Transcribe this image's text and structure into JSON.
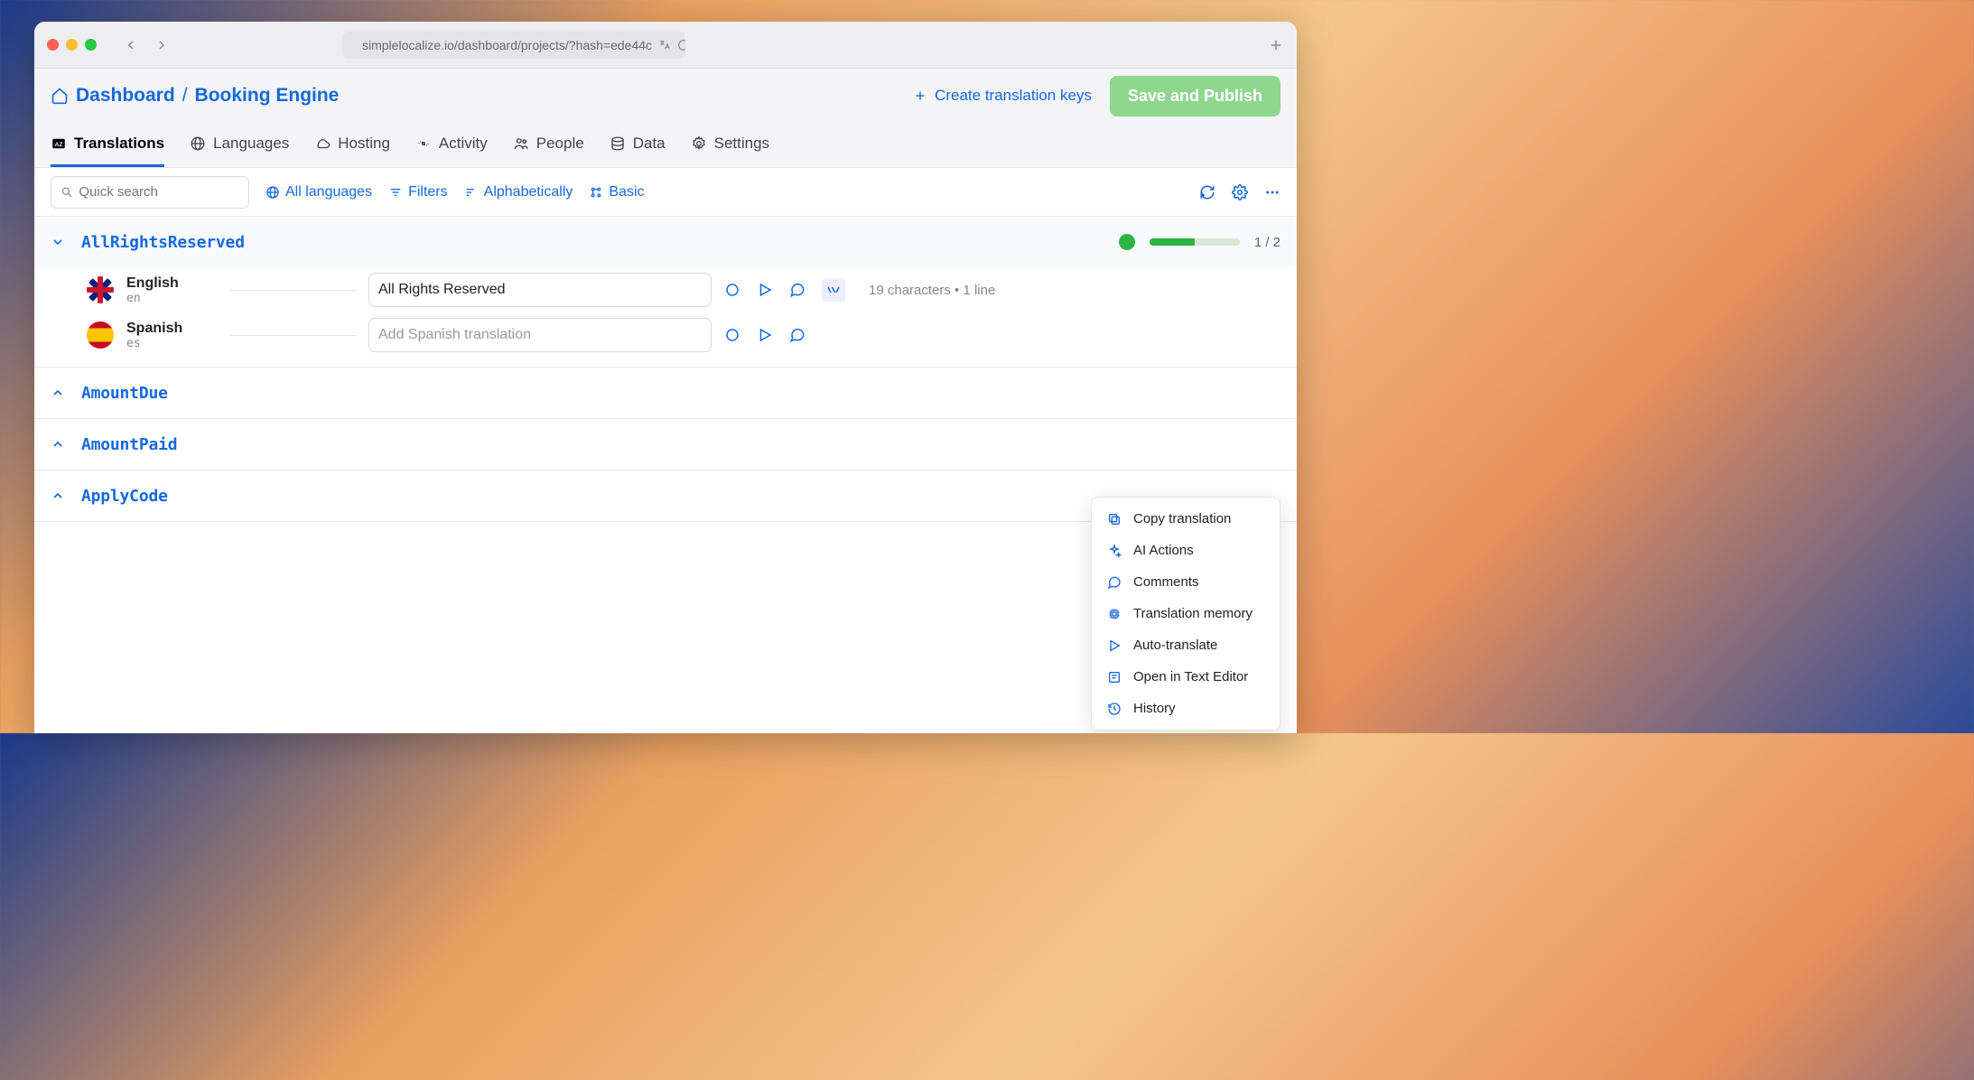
{
  "browser": {
    "url": "simplelocalize.io/dashboard/projects/?hash=ede44c"
  },
  "header": {
    "dashboard_label": "Dashboard",
    "separator": "/",
    "project_name": "Booking Engine",
    "create_keys_label": "Create translation keys",
    "publish_label": "Save and Publish"
  },
  "tabs": [
    {
      "label": "Translations",
      "active": true
    },
    {
      "label": "Languages",
      "active": false
    },
    {
      "label": "Hosting",
      "active": false
    },
    {
      "label": "Activity",
      "active": false
    },
    {
      "label": "People",
      "active": false
    },
    {
      "label": "Data",
      "active": false
    },
    {
      "label": "Settings",
      "active": false
    }
  ],
  "toolbar": {
    "search_placeholder": "Quick search",
    "all_languages": "All languages",
    "filters": "Filters",
    "sort": "Alphabetically",
    "view": "Basic"
  },
  "keys": [
    {
      "name": "AllRightsReserved",
      "expanded": true,
      "progress_done": 1,
      "progress_total": 2,
      "progress_text": "1 / 2",
      "translations": [
        {
          "lang_name": "English",
          "lang_code": "en",
          "flag": "uk",
          "value": "All Rights Reserved",
          "placeholder": "",
          "char_info": "19 characters • 1 line"
        },
        {
          "lang_name": "Spanish",
          "lang_code": "es",
          "flag": "es",
          "value": "",
          "placeholder": "Add Spanish translation",
          "char_info": ""
        }
      ]
    },
    {
      "name": "AmountDue",
      "expanded": false
    },
    {
      "name": "AmountPaid",
      "expanded": false
    },
    {
      "name": "ApplyCode",
      "expanded": false
    }
  ],
  "context_menu": [
    {
      "label": "Copy translation",
      "icon": "copy"
    },
    {
      "label": "AI Actions",
      "icon": "sparkle"
    },
    {
      "label": "Comments",
      "icon": "comment"
    },
    {
      "label": "Translation memory",
      "icon": "chip"
    },
    {
      "label": "Auto-translate",
      "icon": "play"
    },
    {
      "label": "Open in Text Editor",
      "icon": "editor"
    },
    {
      "label": "History",
      "icon": "history"
    }
  ]
}
